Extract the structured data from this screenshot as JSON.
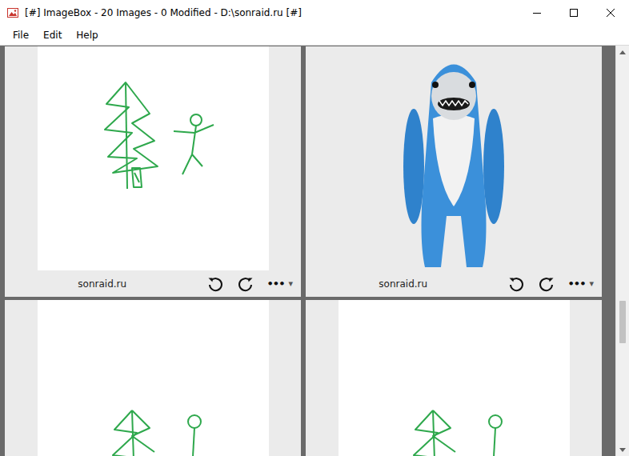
{
  "window": {
    "title": "[#] ImageBox - 20 Images - 0 Modified - D:\\sonraid.ru [#]"
  },
  "menu": [
    "File",
    "Edit",
    "Help"
  ],
  "card_actions": {
    "more": "•••",
    "menu": "▾"
  },
  "images": [
    {
      "caption": "sonraid.ru",
      "kind": "sketch"
    },
    {
      "caption": "sonraid.ru",
      "kind": "photo"
    },
    {
      "kind": "sketch-top"
    },
    {
      "kind": "sketch-top"
    }
  ],
  "scrollbar": {
    "start": 0.63,
    "size": 0.11
  }
}
